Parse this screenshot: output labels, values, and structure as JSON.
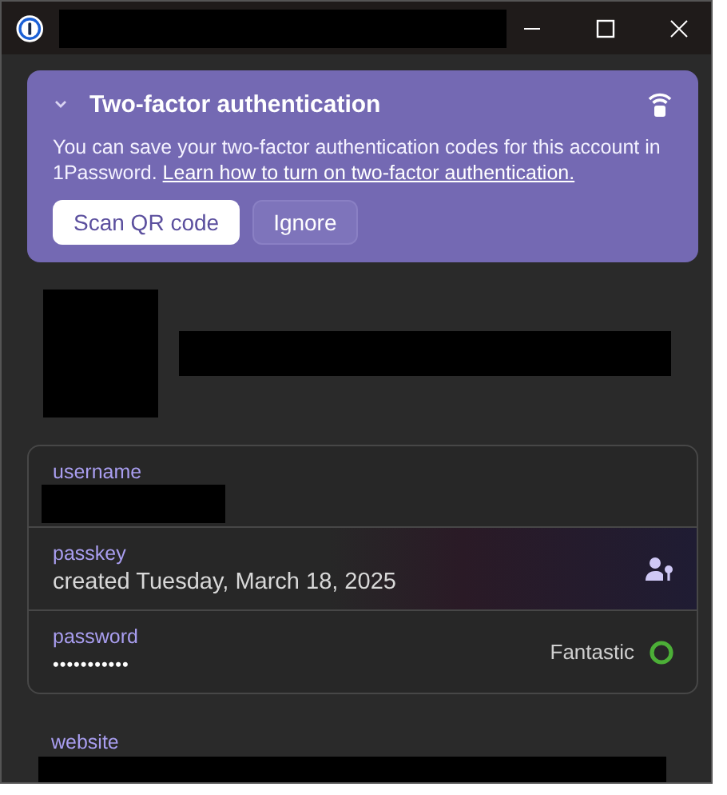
{
  "banner": {
    "title": "Two-factor authentication",
    "expanded": true,
    "text": "You can save your two-factor authentication codes for this account in 1Password.",
    "link": "Learn how to turn on two-factor authentication.",
    "buttons": [
      {
        "label": "Scan QR code",
        "kind": "primary"
      },
      {
        "label": "Ignore",
        "kind": "secondary"
      }
    ]
  },
  "fields": [
    {
      "kind": "redacted",
      "label": "username"
    },
    {
      "kind": "passkey",
      "label": "passkey",
      "value": "created Tuesday, March 18, 2025"
    },
    {
      "kind": "password",
      "label": "password",
      "value": "•••••••••••",
      "strength": "Fantastic"
    }
  ],
  "website": {
    "label": "website"
  }
}
